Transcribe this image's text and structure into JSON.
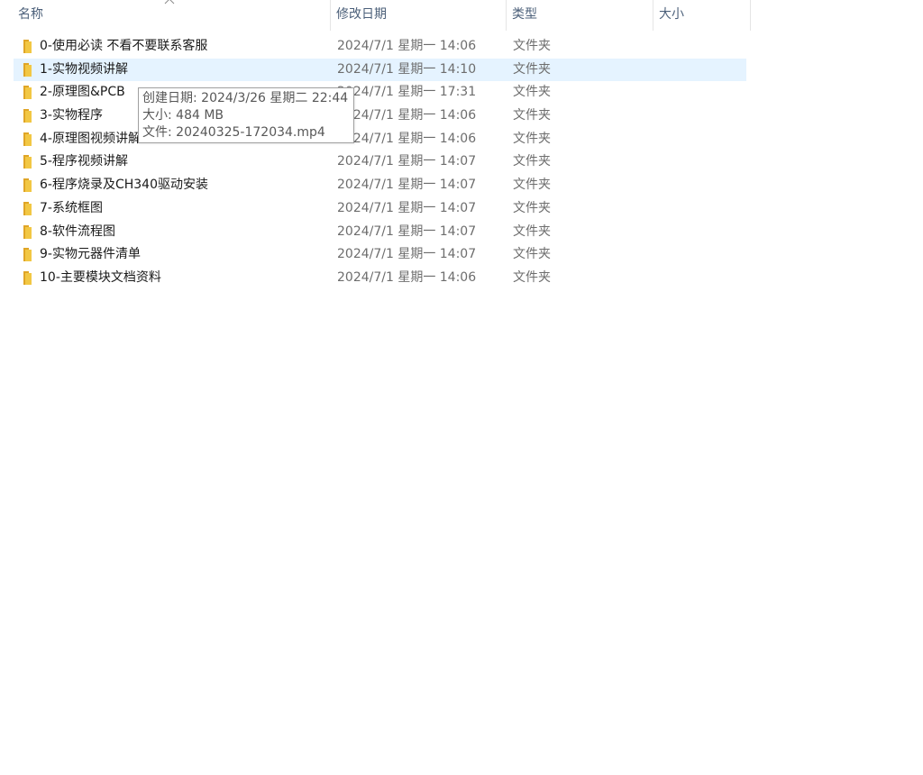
{
  "header": {
    "name": "名称",
    "date": "修改日期",
    "type": "类型",
    "size": "大小"
  },
  "icons": {
    "folder": "folder-icon",
    "sort": "chevron-up-icon"
  },
  "colors": {
    "folder": "#f2c744",
    "selection": "#e5f3ff",
    "header_text": "#4c607a"
  },
  "rows": [
    {
      "name": "0-使用必读  不看不要联系客服",
      "date": "2024/7/1 星期一 14:06",
      "type": "文件夹",
      "size": ""
    },
    {
      "name": "1-实物视频讲解",
      "date": "2024/7/1 星期一 14:10",
      "type": "文件夹",
      "size": "",
      "selected": true
    },
    {
      "name": "2-原理图&PCB",
      "date": "2024/7/1 星期一 17:31",
      "type": "文件夹",
      "size": ""
    },
    {
      "name": "3-实物程序",
      "date": "2024/7/1 星期一 14:06",
      "type": "文件夹",
      "size": ""
    },
    {
      "name": "4-原理图视频讲解",
      "date": "2024/7/1 星期一 14:06",
      "type": "文件夹",
      "size": ""
    },
    {
      "name": "5-程序视频讲解",
      "date": "2024/7/1 星期一 14:07",
      "type": "文件夹",
      "size": ""
    },
    {
      "name": "6-程序烧录及CH340驱动安装",
      "date": "2024/7/1 星期一 14:07",
      "type": "文件夹",
      "size": ""
    },
    {
      "name": "7-系统框图",
      "date": "2024/7/1 星期一 14:07",
      "type": "文件夹",
      "size": ""
    },
    {
      "name": "8-软件流程图",
      "date": "2024/7/1 星期一 14:07",
      "type": "文件夹",
      "size": ""
    },
    {
      "name": "9-实物元器件清单",
      "date": "2024/7/1 星期一 14:07",
      "type": "文件夹",
      "size": ""
    },
    {
      "name": "10-主要模块文档资料",
      "date": "2024/7/1 星期一 14:06",
      "type": "文件夹",
      "size": ""
    }
  ],
  "tooltip": {
    "created": "创建日期: 2024/3/26 星期二 22:44",
    "size": "大小: 484 MB",
    "files": "文件: 20240325-172034.mp4"
  }
}
